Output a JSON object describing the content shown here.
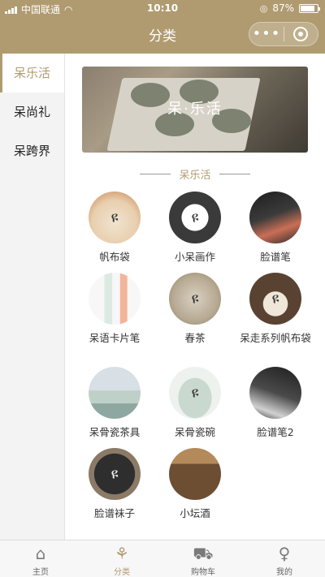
{
  "status": {
    "carrier": "中国联通",
    "time": "10:10",
    "battery_percent": "87%",
    "battery_level": 0.87
  },
  "nav": {
    "title": "分类",
    "more_label": "•••"
  },
  "sidebar": {
    "items": [
      {
        "label": "呆乐活",
        "active": true
      },
      {
        "label": "呆尚礼",
        "active": false
      },
      {
        "label": "呆跨界",
        "active": false
      }
    ]
  },
  "banner": {
    "title": "呆·乐活"
  },
  "section": {
    "title": "呆乐活"
  },
  "products": [
    {
      "name": "帆布袋",
      "icon": "tote-bag-thumb"
    },
    {
      "name": "小呆画作",
      "icon": "painting-thumb"
    },
    {
      "name": "脸谱笔",
      "icon": "opera-pen-thumb"
    },
    {
      "name": "呆语卡片笔",
      "icon": "card-pen-thumb"
    },
    {
      "name": "春茶",
      "icon": "spring-tea-thumb"
    },
    {
      "name": "呆走系列帆布袋",
      "icon": "canvas-bag-thumb"
    },
    {
      "name": "呆骨瓷茶具",
      "icon": "tea-set-thumb"
    },
    {
      "name": "呆骨瓷碗",
      "icon": "porcelain-bowl-thumb"
    },
    {
      "name": "脸谱笔2",
      "icon": "opera-pen-2-thumb"
    },
    {
      "name": "脸谱袜子",
      "icon": "opera-socks-thumb"
    },
    {
      "name": "小坛酒",
      "icon": "jar-wine-thumb"
    }
  ],
  "tabbar": {
    "items": [
      {
        "label": "主页",
        "icon": "home-icon",
        "active": false
      },
      {
        "label": "分类",
        "icon": "category-icon",
        "active": true
      },
      {
        "label": "购物车",
        "icon": "cart-icon",
        "active": false
      },
      {
        "label": "我的",
        "icon": "profile-icon",
        "active": false
      }
    ]
  },
  "colors": {
    "accent": "#b09b70",
    "sidebar_bg": "#f3f3f3",
    "tabbar_bg": "#f7f7f7"
  }
}
